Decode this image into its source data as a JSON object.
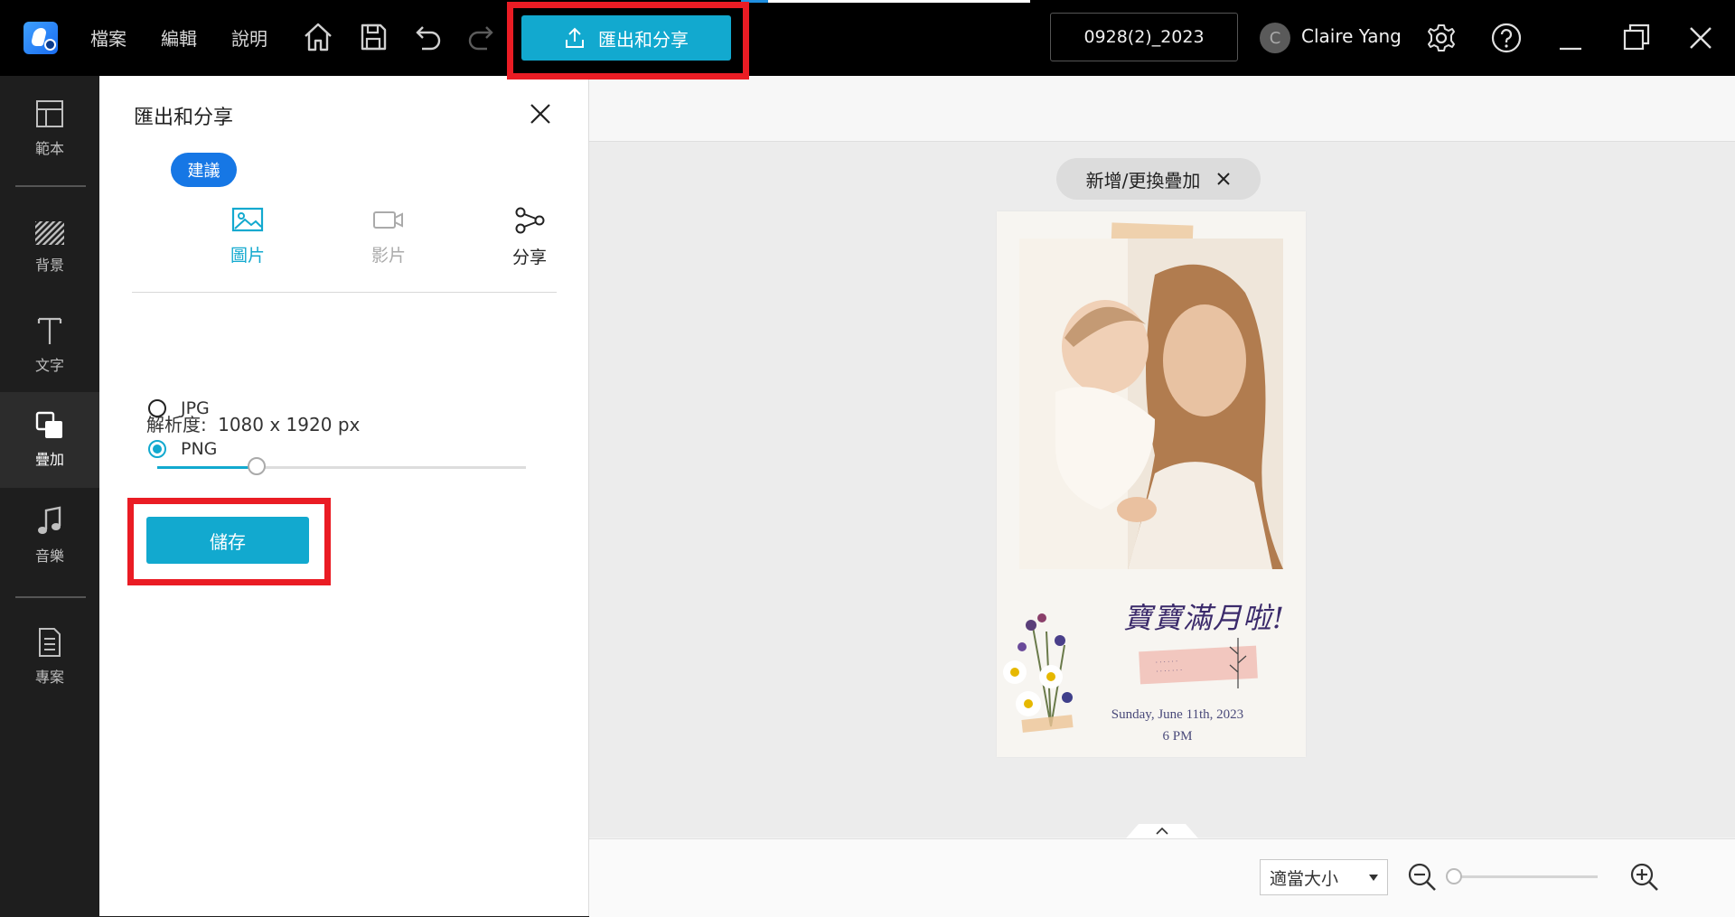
{
  "topbar": {
    "menu": [
      "檔案",
      "編輯",
      "說明"
    ],
    "export_label": "匯出和分享",
    "project_name": "0928(2)_2023",
    "avatar_initial": "C",
    "username": "Claire Yang"
  },
  "rail": {
    "items": [
      {
        "label": "範本",
        "icon": "template-icon"
      },
      {
        "label": "背景",
        "icon": "background-icon"
      },
      {
        "label": "文字",
        "icon": "text-icon"
      },
      {
        "label": "疊加",
        "icon": "overlay-icon",
        "active": true
      },
      {
        "label": "音樂",
        "icon": "music-icon"
      },
      {
        "label": "專案",
        "icon": "project-icon"
      }
    ]
  },
  "panel": {
    "title": "匯出和分享",
    "badge": "建議",
    "tabs": [
      {
        "label": "圖片",
        "icon": "image-icon",
        "state": "active"
      },
      {
        "label": "影片",
        "icon": "video-icon",
        "state": "disabled"
      },
      {
        "label": "分享",
        "icon": "share-icon",
        "state": "normal"
      }
    ],
    "formats": [
      {
        "label": "JPG",
        "checked": false
      },
      {
        "label": "PNG",
        "checked": true
      }
    ],
    "resolution_label": "解析度:",
    "resolution_value": "1080 x 1920 px",
    "resolution_level": 0.27,
    "save_label": "儲存"
  },
  "workspace": {
    "overlay_chip": "新增/更換疊加",
    "card": {
      "heading": "寶寶滿月啦!",
      "date_line1": "Sunday, June 11th, 2023",
      "date_line2": "6 PM"
    },
    "zoom_select": "適當大小",
    "zoom_level": 0.02
  },
  "colors": {
    "accent": "#12a9cf",
    "badge": "#1677e5",
    "highlight": "#ea1c24",
    "topbar": "#000000",
    "rail": "#1e1e1e"
  }
}
